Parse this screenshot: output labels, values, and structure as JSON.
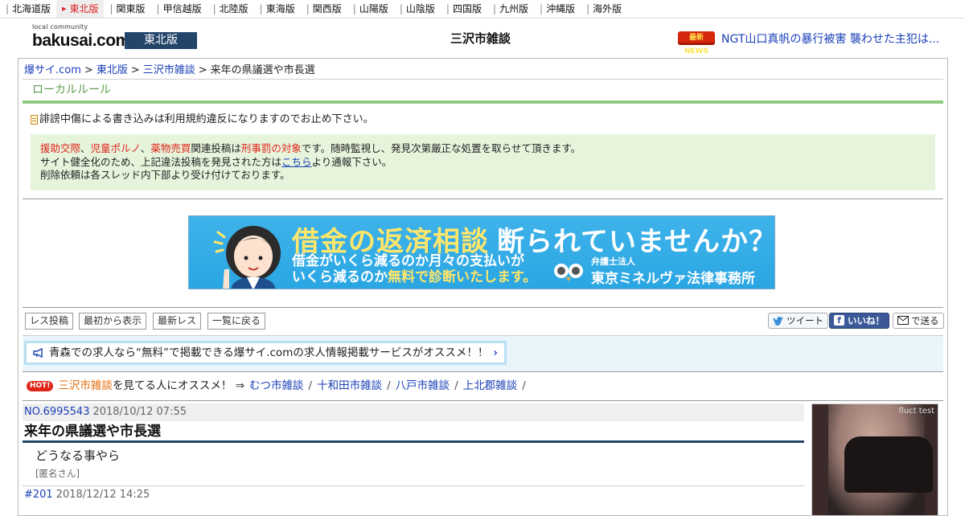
{
  "regions": [
    {
      "label": "北海道版",
      "active": false
    },
    {
      "label": "東北版",
      "active": true
    },
    {
      "label": "関東版",
      "active": false
    },
    {
      "label": "甲信越版",
      "active": false
    },
    {
      "label": "北陸版",
      "active": false
    },
    {
      "label": "東海版",
      "active": false
    },
    {
      "label": "関西版",
      "active": false
    },
    {
      "label": "山陽版",
      "active": false
    },
    {
      "label": "山陰版",
      "active": false
    },
    {
      "label": "四国版",
      "active": false
    },
    {
      "label": "九州版",
      "active": false
    },
    {
      "label": "沖縄版",
      "active": false
    },
    {
      "label": "海外版",
      "active": false
    }
  ],
  "header": {
    "logo_small": "local community",
    "logo_big": "bakusai.com",
    "edition": "東北版",
    "board_title": "三沢市雑談",
    "news_badge": "最新NEWS",
    "news_text": "NGT山口真帆の暴行被害 襲わせた主犯は..."
  },
  "breadcrumb": {
    "home": "爆サイ.com",
    "region": "東北版",
    "board": "三沢市雑談",
    "sep": ">",
    "current": "来年の県議選や市長選"
  },
  "local_rules": {
    "heading": "ローカルルール",
    "warning": "誹謗中傷による書き込みは利用規約違反になりますのでお止め下さい。",
    "notice": {
      "term1": "援助交際",
      "comma1": "、",
      "term2": "児童ポルノ",
      "comma2": "、",
      "term3": "薬物売買",
      "mid1": "関連投稿は",
      "term4": "刑事罰の対象",
      "end1": "です。随時監視し、発見次第厳正な処置を取らせて頂きます。",
      "line2a": "サイト健全化のため、上記違法投稿を発見された方は",
      "line2_link": "こちら",
      "line2b": "より通報下さい。",
      "line3": "削除依頼は各スレッド内下部より受け付けております。"
    }
  },
  "ad": {
    "headline": "借金の返済相談",
    "headline_white": "断られていませんか？",
    "body_line1": "借金がいくら減るのか月々の支払いが",
    "body_line2a": "いくら減るのか",
    "body_line2b": "無料で診断いたします。",
    "firm_small": "弁護士法人",
    "firm": "東京ミネルヴァ法律事務所"
  },
  "toolbar": {
    "post": "レス投稿",
    "from_start": "最初から表示",
    "latest": "最新レス",
    "back": "一覧に戻る",
    "tweet": "ツイート",
    "like": "いいね！",
    "send": "で送る"
  },
  "job_banner": {
    "text": "青森での求人なら“無料”で掲載できる爆サイ.comの求人情報掲載サービスがオススメ！！"
  },
  "recommend": {
    "badge": "HOT!",
    "board": "三沢市雑談",
    "text": "を見てる人にオススメ！ ⇒",
    "links": [
      "むつ市雑談",
      "十和田市雑談",
      "八戸市雑談",
      "上北郡雑談"
    ],
    "slash": "/"
  },
  "post": {
    "number": "NO.6995543",
    "date": "2018/10/12 07:55",
    "title": "来年の県議選や市長選",
    "body": "どうなる事やら",
    "author": "[匿名さん]"
  },
  "reply": {
    "number": "#201",
    "date": "2018/12/12 14:25"
  },
  "side_ad": {
    "tag": "fluct test"
  }
}
